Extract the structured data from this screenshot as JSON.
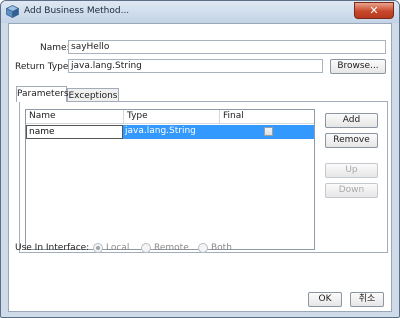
{
  "window": {
    "title": "Add Business Method..."
  },
  "form": {
    "name_label": "Name:",
    "name_value": "sayHello",
    "return_type_label": "Return Type:",
    "return_type_value": "java.lang.String",
    "browse_label": "Browse..."
  },
  "tabs": [
    {
      "label": "Parameters",
      "active": true
    },
    {
      "label": "Exceptions",
      "active": false
    }
  ],
  "parameters_table": {
    "columns": [
      "Name",
      "Type",
      "Final"
    ],
    "rows": [
      {
        "name": "name",
        "type": "java.lang.String",
        "final": false,
        "selected": true,
        "editing": true
      }
    ]
  },
  "side_buttons": {
    "add": "Add",
    "remove": "Remove",
    "up": "Up",
    "down": "Down"
  },
  "interface": {
    "label": "Use In Interface:",
    "options": [
      "Local",
      "Remote",
      "Both"
    ],
    "selected": "Local",
    "enabled": false
  },
  "footer": {
    "ok": "OK",
    "cancel": "취소"
  },
  "colors": {
    "selection": "#3399ff",
    "frame": "#cfdbe9",
    "close": "#c8472b"
  }
}
